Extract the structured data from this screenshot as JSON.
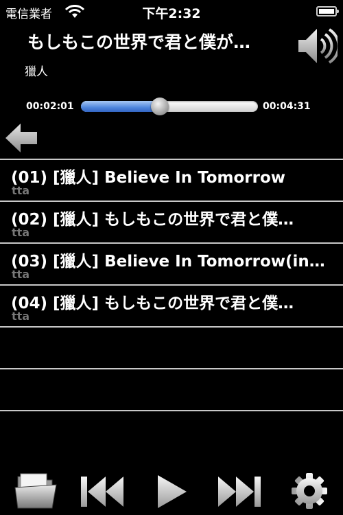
{
  "status_bar": {
    "carrier": "電信業者",
    "time": "下午2:32"
  },
  "now_playing": {
    "title": "もしもこの世界で君と僕が…",
    "artist": "獵人"
  },
  "progress": {
    "elapsed": "00:02:01",
    "total": "00:04:31",
    "fraction": 0.4465
  },
  "playlist": {
    "items": [
      {
        "title": "(01) [獵人] Believe In Tomorrow",
        "subtitle": "tta"
      },
      {
        "title": "(02) [獵人]  もしもこの世界で君と僕…",
        "subtitle": "tta"
      },
      {
        "title": "(03) [獵人] Believe In Tomorrow(in…",
        "subtitle": "tta"
      },
      {
        "title": "(04) [獵人] もしもこの世界で君と僕…",
        "subtitle": "tta"
      }
    ],
    "empty_rows": 3
  },
  "icons": {
    "wifi": "wifi-icon",
    "battery": "battery-icon",
    "volume": "speaker-icon",
    "back": "back-arrow-icon",
    "folder": "folder-icon",
    "previous": "previous-track-icon",
    "play": "play-icon",
    "next": "next-track-icon",
    "settings": "gear-icon"
  },
  "colors": {
    "background": "#000000",
    "progress_fill": "#4f86dc",
    "subtitle": "#777777",
    "divider": "#c8c8c8"
  }
}
